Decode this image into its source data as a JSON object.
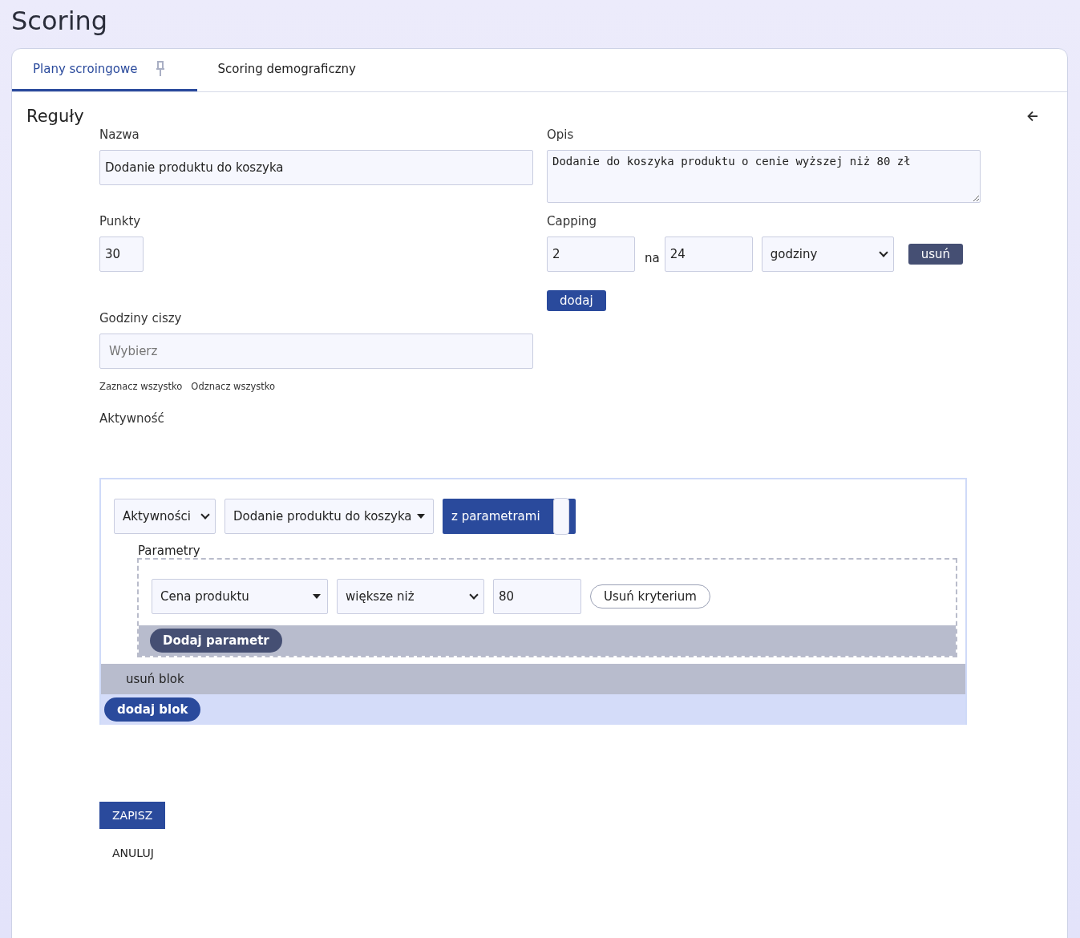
{
  "page_title": "Scoring",
  "tabs": [
    {
      "label": "Plany scroingowe",
      "selected": true,
      "pinned": true
    },
    {
      "label": "Scoring demograficzny",
      "selected": false,
      "pinned": false
    }
  ],
  "section": {
    "title": "Reguły"
  },
  "form": {
    "name": {
      "label": "Nazwa",
      "value": "Dodanie produktu do koszyka"
    },
    "description": {
      "label": "Opis",
      "value": "Dodanie do koszyka produktu o cenie wyższej niż 80 zł"
    },
    "points": {
      "label": "Punkty",
      "value": "30"
    },
    "capping": {
      "label": "Capping",
      "rows": [
        {
          "count": "2",
          "separator": "na",
          "period": "24",
          "unit": "godziny",
          "remove": "usuń"
        }
      ],
      "add": "dodaj"
    },
    "quiet_hours": {
      "label": "Godziny ciszy",
      "placeholder": "Wybierz",
      "select_all": "Zaznacz wszystko",
      "deselect_all": "Odznacz wszystko"
    },
    "activity": {
      "label": "Aktywność",
      "blocks": [
        {
          "category": "Aktywności",
          "event": "Dodanie produktu do koszyka",
          "toggle": {
            "label": "z parametrami",
            "on": true
          },
          "params_label": "Parametry",
          "params": [
            {
              "field": "Cena produktu",
              "operator": "większe niż",
              "value": "80",
              "remove": "Usuń kryterium"
            }
          ],
          "add_param": "Dodaj parametr",
          "remove_block": "usuń blok"
        }
      ],
      "add_block": "dodaj blok"
    }
  },
  "actions": {
    "save": "ZAPISZ",
    "cancel": "ANULUJ"
  }
}
